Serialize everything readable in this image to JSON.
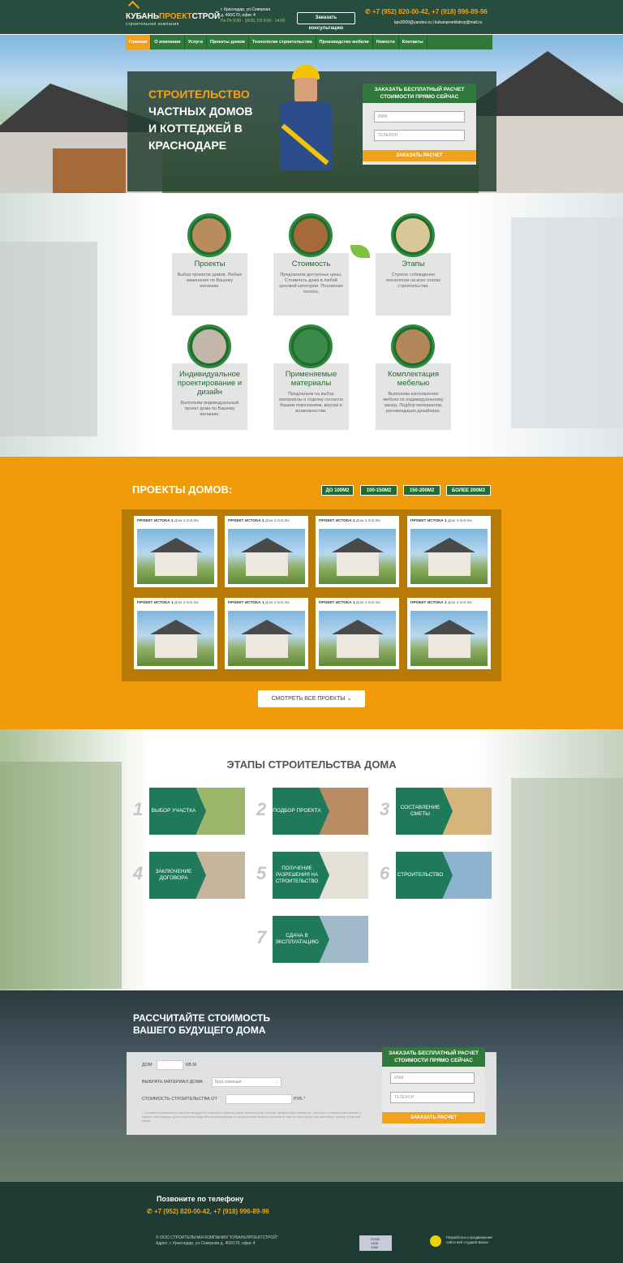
{
  "header": {
    "logo_main": "КУБАНЬ",
    "logo_accent": "ПРОЕКТ",
    "logo_end": "СТРОЙ",
    "logo_sub": "строительная компания",
    "address_line1": "г. Краснодар, ул.Северная",
    "address_line2": "д. 400/170, офис 4",
    "hours": "Пн-Пт 9:00 - 18:00, Сб 9:00 - 14:00",
    "consult_button": "Заказать консультацию",
    "phones": "+7 (952) 820-00-42, +7 (918) 996-89-96",
    "email1": "kps2009@yandex.ru",
    "email2": "kubanproektstroy@mail.ru"
  },
  "nav": {
    "items": [
      "Главная",
      "О компании",
      "Услуги",
      "Проекты домов",
      "Технологии строительства",
      "Производство мебели",
      "Новости",
      "Контакты"
    ]
  },
  "hero": {
    "title_accent": "СТРОИТЕЛЬСТВО",
    "title_rest": "ЧАСТНЫХ ДОМОВ И КОТТЕДЖЕЙ В КРАСНОДАРЕ",
    "form_title": "ЗАКАЗАТЬ БЕСПЛАТНЫЙ РАСЧЕТ СТОИМОСТИ ПРЯМО СЕЙЧАС",
    "name_placeholder": "ИМЯ",
    "phone_placeholder": "ТЕЛЕФОН",
    "submit": "ЗАКАЗАТЬ РАСЧЕТ"
  },
  "features": [
    {
      "title": "Проекты",
      "text": "Выбор проектов домов. Любые изменения по Вашему желанию."
    },
    {
      "title": "Стоимость",
      "text": "Предлагаем доступные цены. Стоимость дома в любой ценовой категории. Поэтапная оплата."
    },
    {
      "title": "Этапы",
      "text": "Строгое соблюдение технологии на всех этапах строительства."
    },
    {
      "title": "Индивидуальное проектирование и дизайн",
      "text": "Выполним индивидуальный проект дома по Вашему желанию."
    },
    {
      "title": "Применяемые материалы",
      "text": "Предлагаем на выбор материалы и отделку согласно Вашим пожеланиям, вкусам и возможностям."
    },
    {
      "title": "Комплектация мебелью",
      "text": "Выполним изготовление мебели по индивидуальному заказу. Подбор материалов, рекомендация дизайнера."
    }
  ],
  "projects": {
    "title": "ПРОЕКТЫ ДОМОВ:",
    "filters": [
      "ДО 100М2",
      "100-150М2",
      "150-200М2",
      "БОЛЕЕ 200М2"
    ],
    "card_title": "ПРОЕКТ ИСТОКА 1",
    "card_size": "Дом 4,0х5,0м",
    "all_button": "СМОТРЕТЬ ВСЕ ПРОЕКТЫ"
  },
  "stages": {
    "title": "ЭТАПЫ СТРОИТЕЛЬСТВА ДОМА",
    "items": [
      {
        "num": "1",
        "label": "ВЫБОР УЧАСТКА"
      },
      {
        "num": "2",
        "label": "ПОДБОР ПРОЕКТА"
      },
      {
        "num": "3",
        "label": "СОСТАВЛЕНИЕ СМЕТЫ"
      },
      {
        "num": "4",
        "label": "ЗАКЛЮЧЕНИЕ ДОГОВОРА"
      },
      {
        "num": "5",
        "label": "ПОЛУЧЕНИЕ РАЗРЕШЕНИЯ НА СТРОИТЕЛЬСТВО"
      },
      {
        "num": "6",
        "label": "СТРОИТЕЛЬСТВО"
      },
      {
        "num": "7",
        "label": "СДАЧА В ЭКСПЛУАТАЦИЮ"
      }
    ]
  },
  "calc": {
    "title_line1": "РАССЧИТАЙТЕ СТОИМОСТЬ",
    "title_line2": "ВАШЕГО БУДУЩЕГО ДОМА",
    "house_label": "ДОМ",
    "unit": "КВ.М",
    "material_label": "ВЫБРАТЬ МАТЕРИАЛ ДОМА",
    "material_selected": "Брус клееный",
    "cost_label": "СТОИМОСТЬ СТРОИТЕЛЬСТВА ОТ",
    "currency": "РУБ.*",
    "note": "* Стоимость указана из расчета квадратного метра в отделке дома. Калькулятор считает примерную стоимость, уточнить стоимость вы можете у нашего менеджера. Для получения подробной информации и консультации можете позвонить нам по телефону или заполнить форму обратной связи.",
    "form_title": "ЗАКАЗАТЬ БЕСПЛАТНЫЙ РАСЧЕТ СТОИМОСТИ ПРЯМО СЕЙЧАС",
    "name_placeholder": "ИМЯ",
    "phone_placeholder": "ТЕЛЕФОН",
    "submit": "ЗАКАЗАТЬ РАСЧЕТ"
  },
  "footer": {
    "call_label": "Позвоните по телефону",
    "phones": "+7 (952) 820-00-42, +7 (918) 996-89-96",
    "copyright": "© ООО СТРОИТЕЛЬНАЯ КОМПАНИЯ \"КУБАНЬПРОЕКТСТРОЙ\"",
    "address": "Адрес: г. Краснодар, ул.Северная д. 400/170, офис 4",
    "counter": [
      "21000",
      "1408",
      "1366"
    ],
    "dev_text": "Разработка и продвижение сайта веб студией Бизон"
  },
  "colors": {
    "accent": "#f0a21a",
    "green": "#1f6d2e",
    "dark": "#274d3e"
  }
}
